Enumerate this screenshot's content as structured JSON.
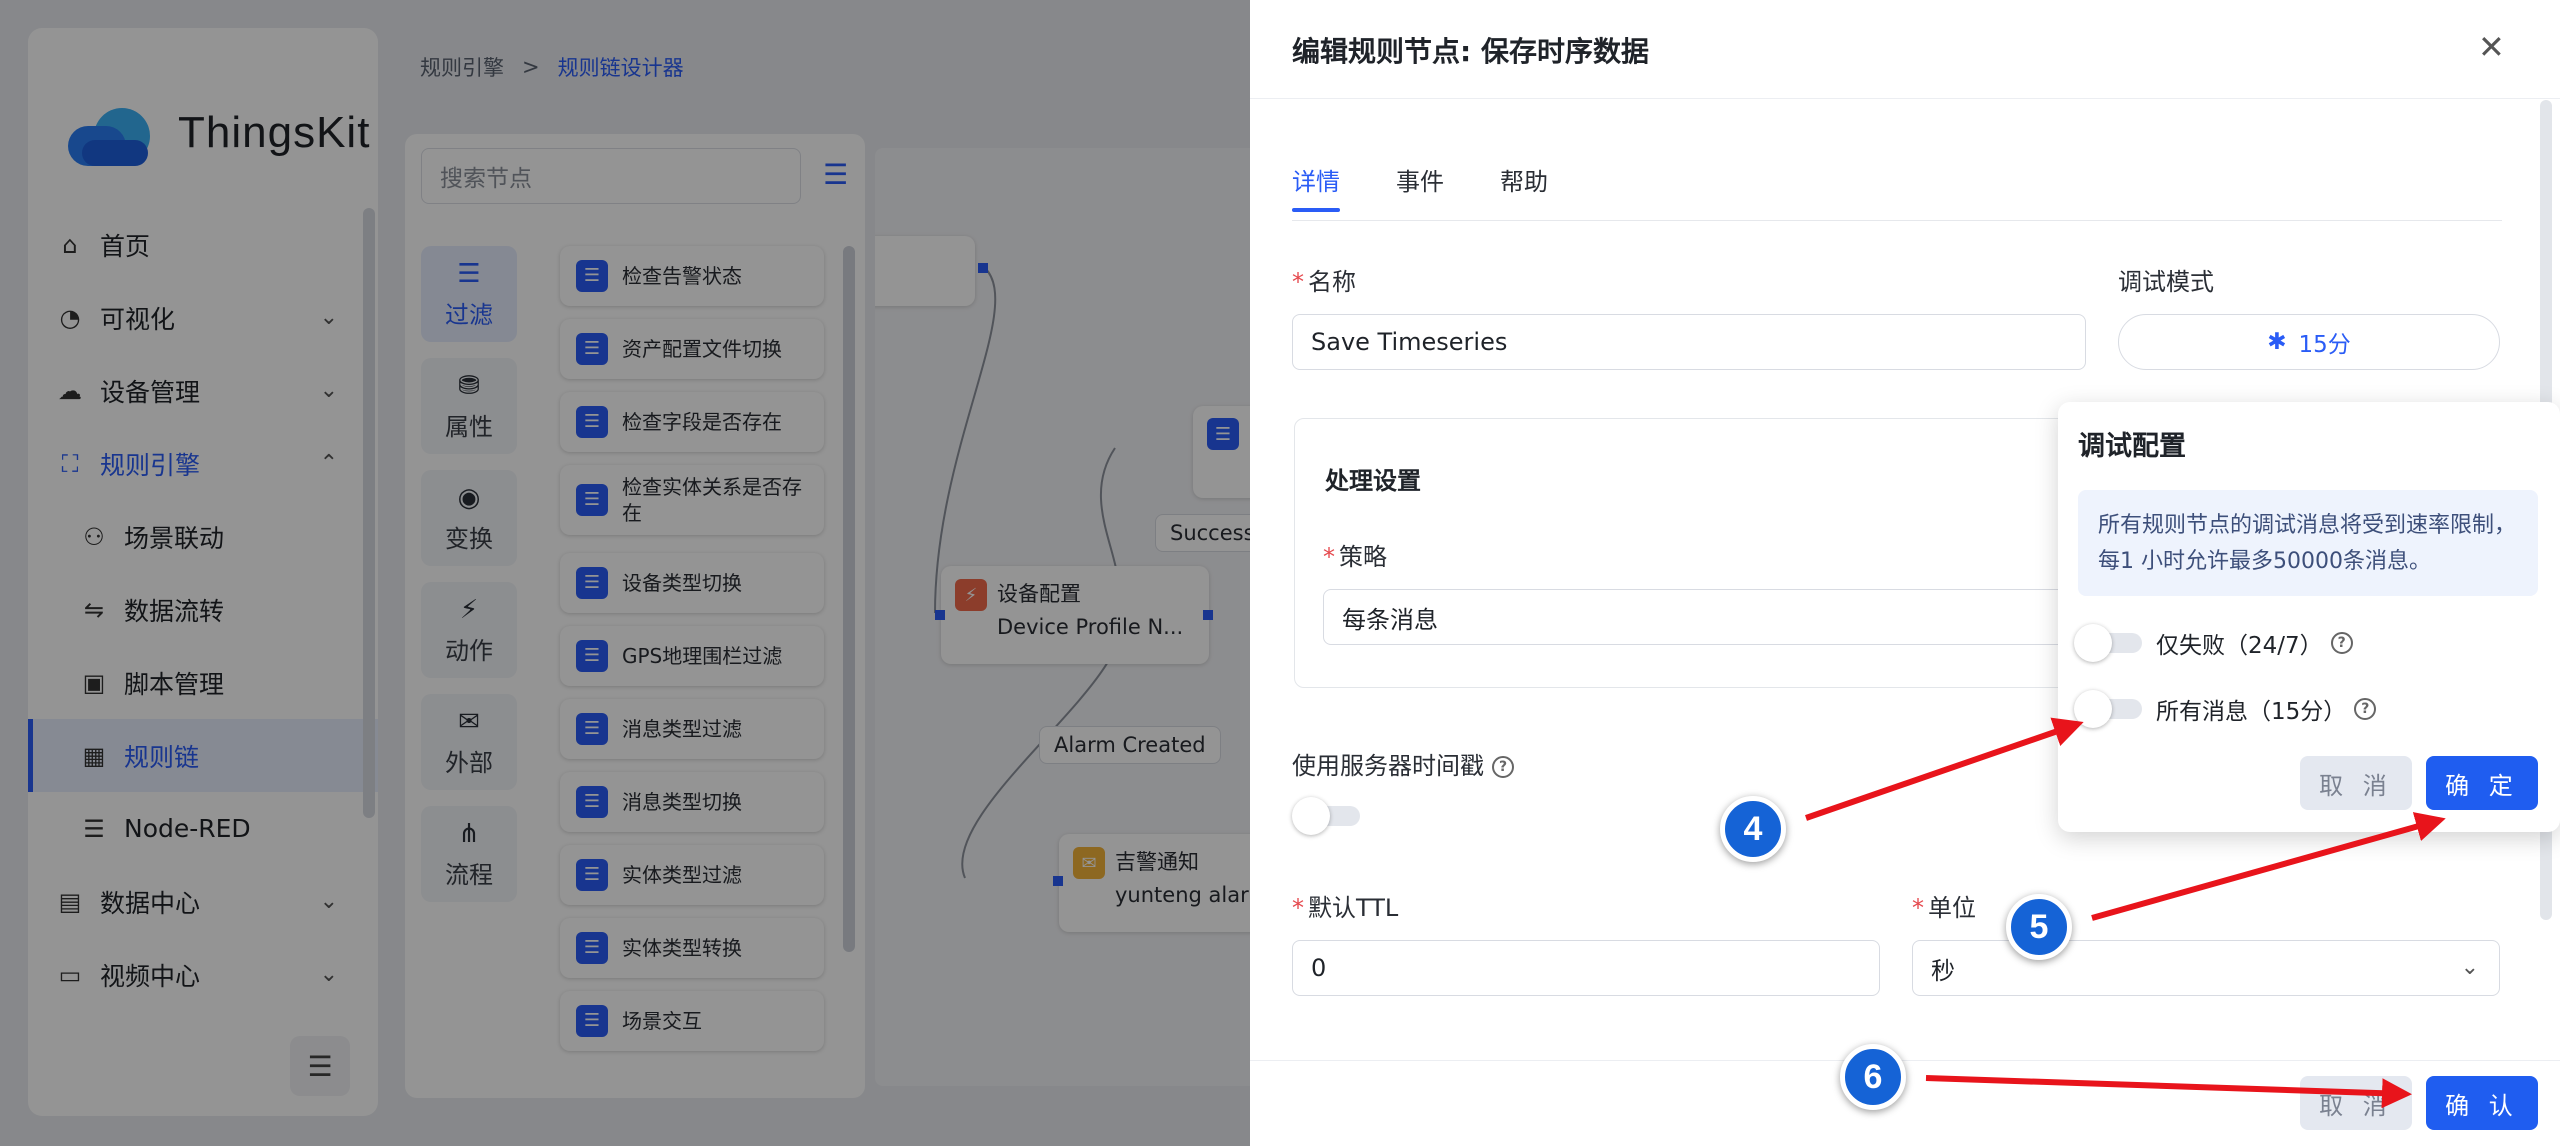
{
  "app": {
    "logo_text": "ThingsKit"
  },
  "sidebar": {
    "items": [
      {
        "label": "首页",
        "icon": "home-icon",
        "glyph": "⌂"
      },
      {
        "label": "可视化",
        "icon": "dashboard-icon",
        "glyph": "◔"
      },
      {
        "label": "设备管理",
        "icon": "device-icon",
        "glyph": "☁"
      },
      {
        "label": "规则引擎",
        "icon": "rule-engine-icon",
        "glyph": "⛶"
      },
      {
        "label": "场景联动",
        "icon": "scene-icon",
        "glyph": "⚇"
      },
      {
        "label": "数据流转",
        "icon": "flow-icon",
        "glyph": "⇋"
      },
      {
        "label": "脚本管理",
        "icon": "script-icon",
        "glyph": "▣"
      },
      {
        "label": "规则链",
        "icon": "rule-chain-icon",
        "glyph": "▦"
      },
      {
        "label": "Node-RED",
        "icon": "node-red-icon",
        "glyph": "☰"
      },
      {
        "label": "数据中心",
        "icon": "data-center-icon",
        "glyph": "▤"
      },
      {
        "label": "视频中心",
        "icon": "video-icon",
        "glyph": "▭"
      }
    ]
  },
  "breadcrumb": {
    "root": "规则引擎",
    "sep": ">",
    "current": "规则链设计器"
  },
  "library": {
    "search_placeholder": "搜索节点",
    "categories": [
      {
        "label": "过滤",
        "glyph": "☰"
      },
      {
        "label": "属性",
        "glyph": "⛃"
      },
      {
        "label": "变换",
        "glyph": "◉"
      },
      {
        "label": "动作",
        "glyph": "⚡"
      },
      {
        "label": "外部",
        "glyph": "✉"
      },
      {
        "label": "流程",
        "glyph": "⋔"
      }
    ],
    "nodes": [
      "检查告警状态",
      "资产配置文件切换",
      "检查字段是否存在",
      "检查实体关系是否存在",
      "设备类型切换",
      "GPS地理围栏过滤",
      "消息类型过滤",
      "消息类型切换",
      "实体类型过滤",
      "实体类型转换",
      "场景交互"
    ]
  },
  "canvas": {
    "node1": {
      "title": "设备配置",
      "subtitle": "Device Profile N..."
    },
    "node2": {
      "title": "吉警通知",
      "subtitle": "yunteng alarm"
    },
    "edge_success": "Success",
    "edge_alarm": "Alarm Created"
  },
  "drawer": {
    "title": "编辑规则节点: 保存时序数据",
    "tabs": [
      "详情",
      "事件",
      "帮助"
    ],
    "name_label": "名称",
    "name_value": "Save Timeseries",
    "debug_label": "调试模式",
    "debug_value": "15分",
    "section_title": "处理设置",
    "strategy_label": "策略",
    "strategy_value": "每条消息",
    "server_ts_label": "使用服务器时间戳",
    "ttl_label": "默认TTL",
    "ttl_value": "0",
    "unit_label": "单位",
    "unit_value": "秒",
    "cancel": "取 消",
    "confirm": "确 认"
  },
  "popover": {
    "title": "调试配置",
    "note": "所有规则节点的调试消息将受到速率限制，每1 小时允许最多50000条消息。",
    "opt_failures": "仅失败（24/7）",
    "opt_all": "所有消息（15分）",
    "cancel": "取 消",
    "confirm": "确 定"
  },
  "annotations": {
    "badge4": "4",
    "badge5": "5",
    "badge6": "6",
    "arrow_color": "#e8141b"
  },
  "colors": {
    "accent": "#2a5cf6",
    "primary_button": "#1f5df0"
  }
}
